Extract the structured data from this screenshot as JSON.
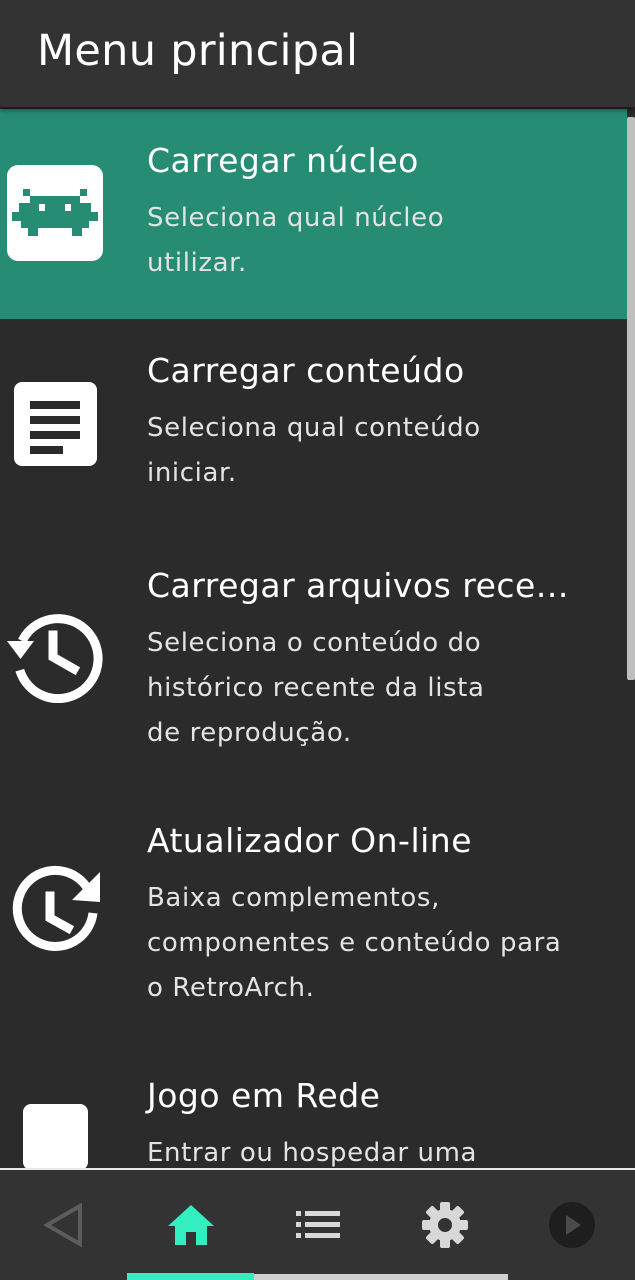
{
  "header": {
    "title": "Menu principal"
  },
  "menu": {
    "items": [
      {
        "icon": "retroarch-invader-icon",
        "title": "Carregar núcleo",
        "subtitle": [
          "Seleciona qual núcleo",
          "utilizar."
        ],
        "selected": true
      },
      {
        "icon": "document-icon",
        "title": "Carregar conteúdo",
        "subtitle": [
          "Seleciona qual conteúdo",
          "iniciar."
        ],
        "selected": false
      },
      {
        "icon": "history-icon",
        "title": "Carregar arquivos rece...",
        "subtitle": [
          "Seleciona o conteúdo do",
          "histórico recente da lista",
          "de reprodução."
        ],
        "selected": false
      },
      {
        "icon": "online-updater-icon",
        "title": "Atualizador On-line",
        "subtitle": [
          "Baixa complementos,",
          "componentes e conteúdo para",
          "o RetroArch."
        ],
        "selected": false
      },
      {
        "icon": "netplay-icon",
        "title": "Jogo em Rede",
        "subtitle": [
          "Entrar ou hospedar uma"
        ],
        "selected": false
      }
    ]
  },
  "tabbar": {
    "tabs": [
      {
        "icon": "back-triangle-icon",
        "active": false
      },
      {
        "icon": "home-icon",
        "active": true
      },
      {
        "icon": "list-icon",
        "active": false
      },
      {
        "icon": "settings-gear-icon",
        "active": false
      },
      {
        "icon": "play-circle-icon",
        "active": false
      }
    ]
  },
  "colors": {
    "background": "#2b2b2b",
    "header": "#333333",
    "selected_row": "#268c74",
    "accent": "#32eec0",
    "text": "#ffffff",
    "subtext": "#e3e3e3"
  }
}
